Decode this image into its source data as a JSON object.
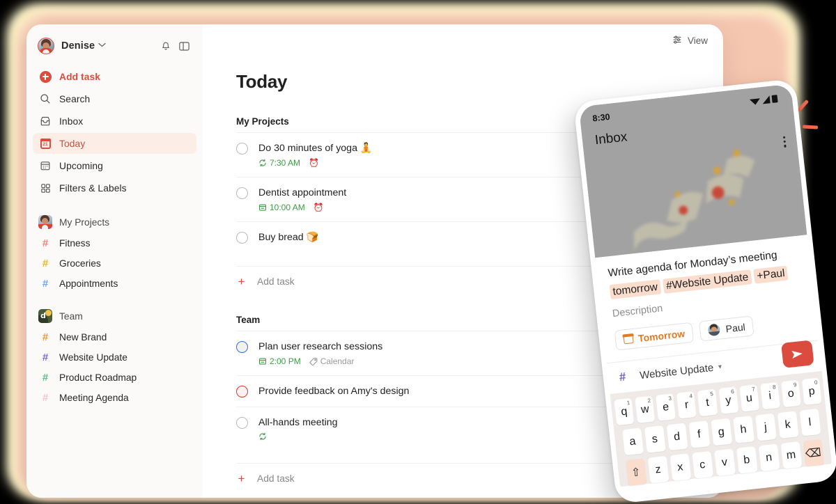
{
  "app": {
    "user_name": "Denise",
    "icons": {
      "chevron": "chevron-down-icon",
      "bell": "bell-icon",
      "panel": "sidebar-toggle-icon"
    }
  },
  "sidebar": {
    "nav": [
      {
        "label": "Add task",
        "icon": "plus-circle-icon"
      },
      {
        "label": "Search",
        "icon": "search-icon"
      },
      {
        "label": "Inbox",
        "icon": "inbox-icon"
      },
      {
        "label": "Today",
        "icon": "calendar-today-icon",
        "badge": "21"
      },
      {
        "label": "Upcoming",
        "icon": "calendar-grid-icon"
      },
      {
        "label": "Filters & Labels",
        "icon": "grid-squares-icon"
      }
    ],
    "groups": [
      {
        "title": "My Projects",
        "icon": "my-projects-avatar",
        "projects": [
          {
            "label": "Fitness",
            "color": "#f2837a"
          },
          {
            "label": "Groceries",
            "color": "#f0b429"
          },
          {
            "label": "Appointments",
            "color": "#6ea8f0"
          }
        ]
      },
      {
        "title": "Team",
        "icon": "team-workspace-logo",
        "projects": [
          {
            "label": "New Brand",
            "color": "#f0973a"
          },
          {
            "label": "Website Update",
            "color": "#7b6ae0"
          },
          {
            "label": "Product Roadmap",
            "color": "#5dc08a"
          },
          {
            "label": "Meeting Agenda",
            "color": "#f2c5d6"
          }
        ]
      }
    ]
  },
  "main": {
    "view_button": "View",
    "page_title": "Today",
    "add_task_label": "Add task",
    "sections": [
      {
        "title": "My Projects",
        "tasks": [
          {
            "title": "Do 30 minutes of yoga 🧘",
            "checkbox": "default",
            "meta": [
              {
                "icon": "repeat-icon",
                "text": "7:30 AM",
                "tone": "green"
              },
              {
                "icon": "alarm-icon",
                "text": "",
                "tone": "grey"
              }
            ]
          },
          {
            "title": "Dentist appointment",
            "checkbox": "default",
            "meta": [
              {
                "icon": "calendar-icon",
                "text": "10:00 AM",
                "tone": "green"
              },
              {
                "icon": "alarm-icon",
                "text": "",
                "tone": "grey"
              }
            ]
          },
          {
            "title": "Buy bread 🍞",
            "checkbox": "default",
            "meta": []
          }
        ]
      },
      {
        "title": "Team",
        "tasks": [
          {
            "title": "Plan user research sessions",
            "checkbox": "blue",
            "meta": [
              {
                "icon": "calendar-icon",
                "text": "2:00 PM",
                "tone": "green"
              },
              {
                "icon": "label-icon",
                "text": "Calendar",
                "tone": "grey"
              }
            ]
          },
          {
            "title": "Provide feedback on Amy's design",
            "checkbox": "red",
            "meta": []
          },
          {
            "title": "All-hands meeting",
            "checkbox": "default",
            "meta": [
              {
                "icon": "repeat-icon",
                "text": "",
                "tone": "green"
              }
            ]
          }
        ]
      }
    ]
  },
  "phone": {
    "status_time": "8:30",
    "screen_title": "Inbox",
    "task_text": "Write agenda for Monday’s meeting",
    "tags": [
      "tomorrow",
      "#Website Update",
      "+Paul"
    ],
    "description_placeholder": "Description",
    "chips": [
      {
        "label": "Tomorrow",
        "icon": "calendar-icon"
      },
      {
        "label": "Paul",
        "icon": "assignee-avatar"
      }
    ],
    "project_selector": {
      "hash": "#",
      "label": "Website Update",
      "caret": "▾"
    },
    "send_icon": "send-icon",
    "keyboard": {
      "row1": [
        {
          "k": "q",
          "n": "1"
        },
        {
          "k": "w",
          "n": "2"
        },
        {
          "k": "e",
          "n": "3"
        },
        {
          "k": "r",
          "n": "4"
        },
        {
          "k": "t",
          "n": "5"
        },
        {
          "k": "y",
          "n": "6"
        },
        {
          "k": "u",
          "n": "7"
        },
        {
          "k": "i",
          "n": "8"
        },
        {
          "k": "o",
          "n": "9"
        },
        {
          "k": "p",
          "n": "0"
        }
      ],
      "row2": [
        "a",
        "s",
        "d",
        "f",
        "g",
        "h",
        "j",
        "k",
        "l"
      ],
      "row3": [
        "⇧",
        "z",
        "x",
        "c",
        "v",
        "b",
        "n",
        "m",
        "⌫"
      ]
    }
  },
  "colors": {
    "brand_red": "#dc4c3e",
    "today_highlight": "#fceee7",
    "green_meta": "#3c9c45",
    "sidebar_bg": "#fcfaf8",
    "tag_bg": "#fbddcd"
  }
}
